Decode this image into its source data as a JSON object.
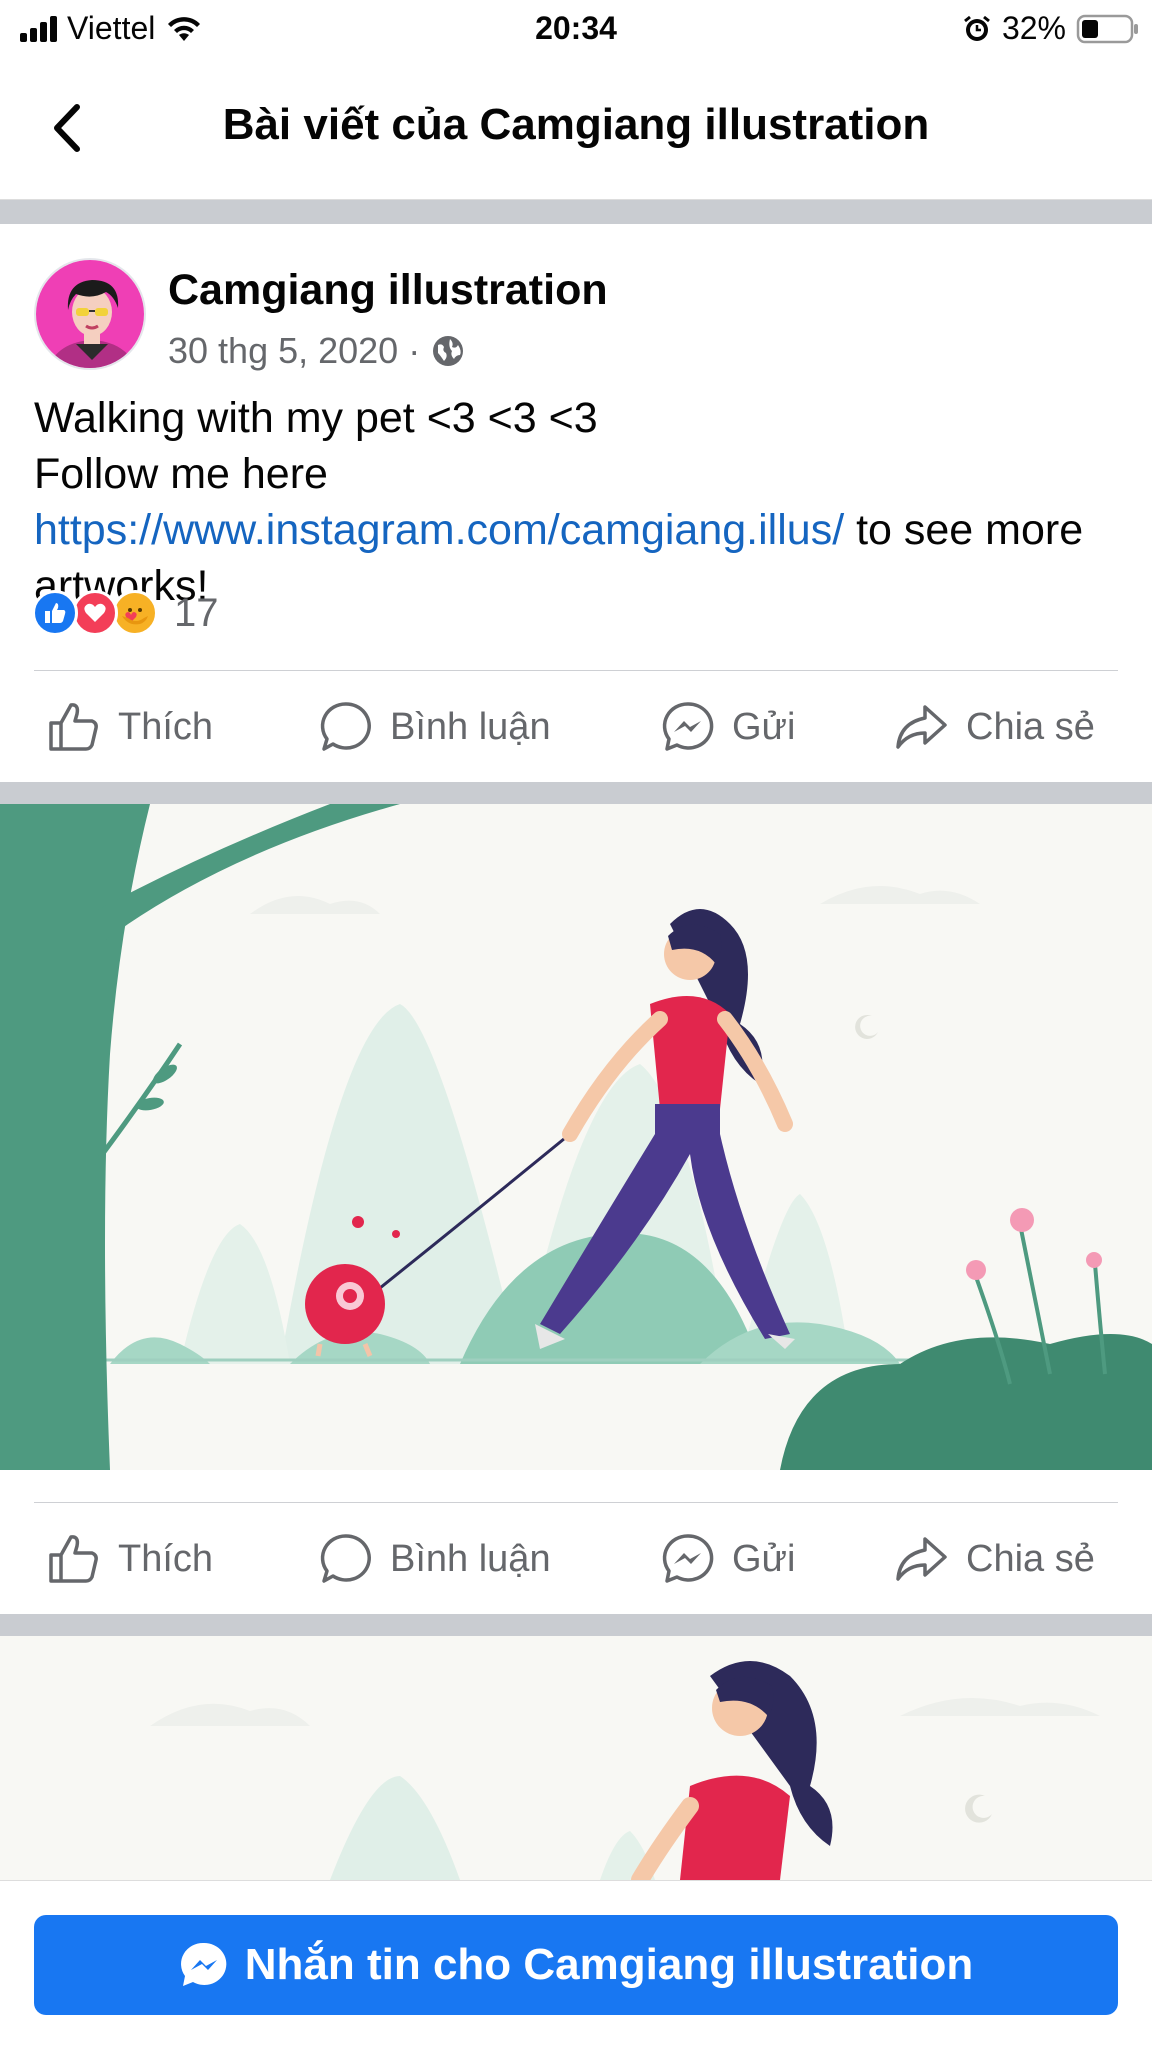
{
  "status_bar": {
    "carrier": "Viettel",
    "time": "20:34",
    "battery": "32%"
  },
  "header": {
    "title": "Bài viết của Camgiang illustration"
  },
  "post": {
    "author": "Camgiang illustration",
    "date": "30 thg 5, 2020",
    "separator": "·",
    "text_line1": "Walking with my pet <3 <3 <3",
    "text_line2_prefix": "Follow me here ",
    "link": "https://www.instagram.com/camgiang.illus/",
    "text_suffix": " to see more artworks!",
    "reaction_count": "17"
  },
  "actions": {
    "like": "Thích",
    "comment": "Bình luận",
    "send": "Gửi",
    "share": "Chia sẻ"
  },
  "footer": {
    "message_button": "Nhắn tin cho Camgiang illustration"
  },
  "colors": {
    "brand_blue": "#1877f2",
    "link": "#1565c0",
    "muted": "#65676b",
    "divider": "#c9ccd1"
  }
}
